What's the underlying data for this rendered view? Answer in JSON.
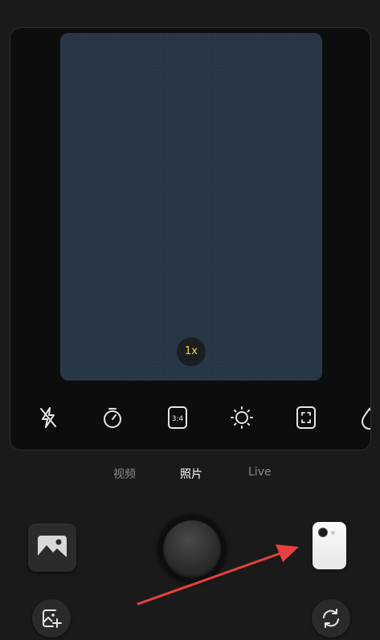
{
  "viewfinder": {
    "zoom_label": "1x"
  },
  "toolbar": {
    "items": [
      {
        "name": "flash-off-icon",
        "label": ""
      },
      {
        "name": "timer-icon",
        "label": ""
      },
      {
        "name": "aspect-ratio-icon",
        "label": "3:4"
      },
      {
        "name": "brightness-icon",
        "label": ""
      },
      {
        "name": "focus-frame-icon",
        "label": ""
      },
      {
        "name": "beauty-icon",
        "label": ""
      }
    ]
  },
  "modes": {
    "items": [
      {
        "label": "视频",
        "active": false
      },
      {
        "label": "照片",
        "active": true
      },
      {
        "label": "Live",
        "active": false
      }
    ]
  },
  "controls": {
    "gallery_icon": "image-icon",
    "shutter_icon": "shutter-button",
    "device_icon": "phone-device-icon",
    "add_photo_icon": "add-photo-icon",
    "switch_camera_icon": "switch-camera-icon"
  },
  "colors": {
    "background": "#1a1a1a",
    "viewfinder": "#263645",
    "zoom_text": "#f2d04a",
    "annotation_arrow": "#e84040"
  }
}
